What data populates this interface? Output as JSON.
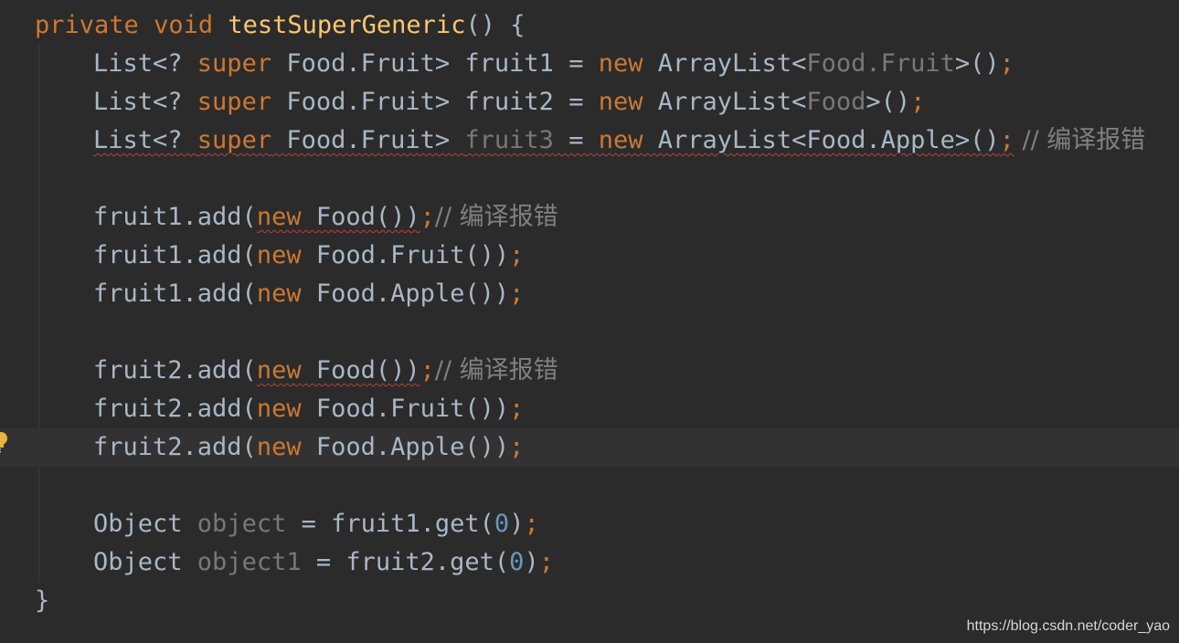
{
  "code": {
    "method_decl": {
      "modifier1": "private",
      "modifier2": "void",
      "name": "testSuperGeneric",
      "suffix": "() {"
    },
    "decl1": {
      "list_prefix": "List<? ",
      "super_kw": "super",
      "type": " Food.Fruit> ",
      "var": "fruit1",
      "eq": " = ",
      "new_kw": "new",
      "ctor": " ArrayList<",
      "type_arg": "Food.Fruit",
      "close": ">()",
      "semi": ";"
    },
    "decl2": {
      "list_prefix": "List<? ",
      "super_kw": "super",
      "type": " Food.Fruit> ",
      "var": "fruit2",
      "eq": " = ",
      "new_kw": "new",
      "ctor": " ArrayList<",
      "type_arg": "Food",
      "close": ">()",
      "semi": ";"
    },
    "decl3": {
      "list_prefix": "List<? ",
      "super_kw": "super",
      "type": " Food.Fruit> ",
      "var": "fruit3",
      "eq": " = ",
      "new_kw": "new",
      "ctor": " ArrayList<Food.Apple>()",
      "semi": ";",
      "comment": " // 编译报错"
    },
    "add1a": {
      "call": "fruit1.add(",
      "new_kw": "new",
      "arg": " Food())",
      "semi": ";",
      "comment": "// 编译报错"
    },
    "add1b": {
      "call": "fruit1.add(",
      "new_kw": "new",
      "arg": " Food.Fruit())",
      "semi": ";"
    },
    "add1c": {
      "call": "fruit1.add(",
      "new_kw": "new",
      "arg": " Food.Apple())",
      "semi": ";"
    },
    "add2a": {
      "call": "fruit2.add(",
      "new_kw": "new",
      "arg": " Food())",
      "semi": ";",
      "comment": "// 编译报错"
    },
    "add2b": {
      "call": "fruit2.add(",
      "new_kw": "new",
      "arg": " Food.Fruit())",
      "semi": ";"
    },
    "add2c": {
      "call": "fruit2.add(",
      "new_kw": "new",
      "arg": " Food.Apple())",
      "semi": ";"
    },
    "get1": {
      "type": "Object ",
      "var": "object",
      "eq": " = fruit1.get(",
      "num": "0",
      "close": ")",
      "semi": ";"
    },
    "get2": {
      "type": "Object ",
      "var": "object1",
      "eq": " = fruit2.get(",
      "num": "0",
      "close": ")",
      "semi": ";"
    },
    "closing": "}"
  },
  "watermark": "https://blog.csdn.net/coder_yao",
  "icons": {
    "gutter": "lightbulb-icon"
  },
  "colors": {
    "background": "#2b2b2b",
    "keyword": "#cc7832",
    "method": "#ffc66d",
    "number": "#6897bb",
    "comment": "#808080",
    "text": "#a9b7c6",
    "error_underline": "#bc3f3c"
  }
}
